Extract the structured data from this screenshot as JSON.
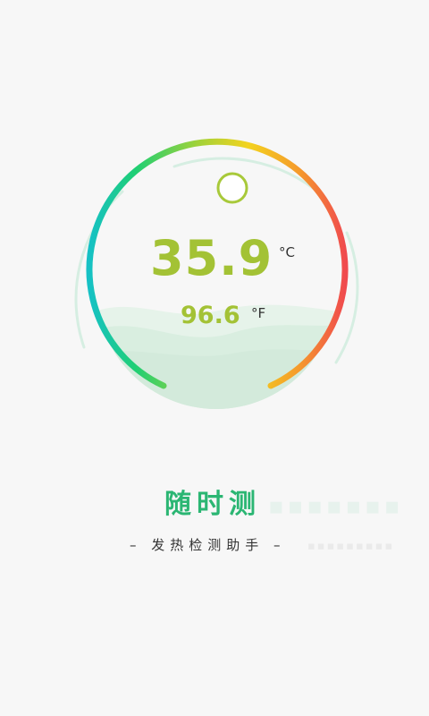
{
  "reading": {
    "celsius": "35.9",
    "celsius_unit": "°C",
    "fahrenheit": "96.6",
    "fahrenheit_unit": "°F"
  },
  "brand": {
    "title": "随时测",
    "subtitle": "– 发热检测助手 –"
  },
  "colors": {
    "accent_green": "#2bb673",
    "reading_green": "#a3c235",
    "arc_start": "#1fc4c0",
    "arc_mid": "#f2d321",
    "arc_end": "#f0484e",
    "wave_fill": "#dcefe3"
  }
}
